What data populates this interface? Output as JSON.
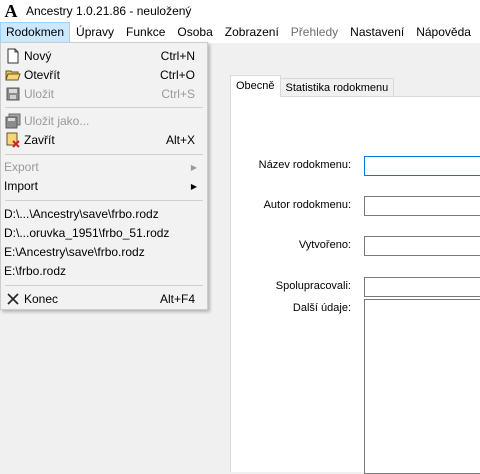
{
  "window": {
    "title": "Ancestry 1.0.21.86 - neuložený",
    "app_icon_glyph": "A"
  },
  "menubar": {
    "items": [
      {
        "label": "Rodokmen",
        "state": "active"
      },
      {
        "label": "Úpravy",
        "state": "normal"
      },
      {
        "label": "Funkce",
        "state": "normal"
      },
      {
        "label": "Osoba",
        "state": "normal"
      },
      {
        "label": "Zobrazení",
        "state": "normal"
      },
      {
        "label": "Přehledy",
        "state": "disabled"
      },
      {
        "label": "Nastavení",
        "state": "normal"
      },
      {
        "label": "Nápověda",
        "state": "normal"
      }
    ]
  },
  "menu": {
    "novy": {
      "label": "Nový",
      "shortcut": "Ctrl+N",
      "icon": "new-file-icon"
    },
    "otevrit": {
      "label": "Otevřít",
      "shortcut": "Ctrl+O",
      "icon": "open-folder-icon"
    },
    "ulozit": {
      "label": "Uložit",
      "shortcut": "Ctrl+S",
      "icon": "save-icon"
    },
    "ulozit_jako": {
      "label": "Uložit jako...",
      "icon": "save-as-icon"
    },
    "zavrit": {
      "label": "Zavřít",
      "shortcut": "Alt+X",
      "icon": "close-file-icon"
    },
    "export": {
      "label": "Export"
    },
    "import": {
      "label": "Import"
    },
    "recent": [
      "D:\\...\\Ancestry\\save\\frbo.rodz",
      "D:\\...oruvka_1951\\frbo_51.rodz",
      "E:\\Ancestry\\save\\frbo.rodz",
      "E:\\frbo.rodz"
    ],
    "konec": {
      "label": "Konec",
      "shortcut": "Alt+F4",
      "icon": "exit-icon"
    }
  },
  "tabs": [
    {
      "label": "Obecně",
      "active": true
    },
    {
      "label": "Statistika rodokmenu",
      "active": false
    }
  ],
  "form": {
    "nazev_label": "Název rodokmenu:",
    "nazev_value": "",
    "autor_label": "Autor rodokmenu:",
    "autor_value": "",
    "vytvoreno_label": "Vytvořeno:",
    "vytvoreno_value": "",
    "spolupracovali_label": "Spolupracovali:",
    "spolupracovali_value": "",
    "dalsi_label": "Další údaje:",
    "dalsi_value": ""
  },
  "colors": {
    "menu_active_bg": "#cce8ff",
    "menu_active_border": "#99d1ff",
    "focus_border": "#0078d7"
  }
}
